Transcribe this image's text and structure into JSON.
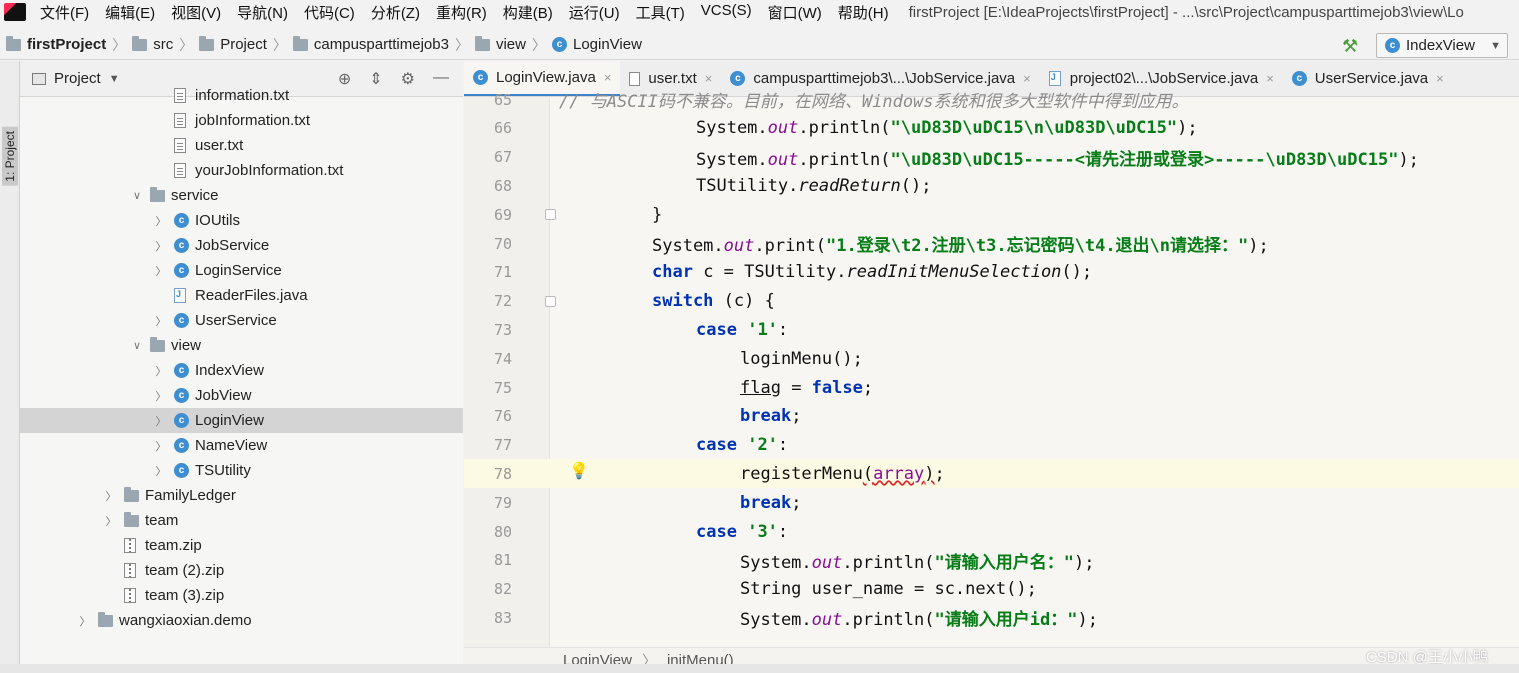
{
  "menubar": {
    "items": [
      "文件(F)",
      "编辑(E)",
      "视图(V)",
      "导航(N)",
      "代码(C)",
      "分析(Z)",
      "重构(R)",
      "构建(B)",
      "运行(U)",
      "工具(T)",
      "VCS(S)",
      "窗口(W)",
      "帮助(H)"
    ],
    "window_title": "firstProject [E:\\IdeaProjects\\firstProject] - ...\\src\\Project\\campusparttimejob3\\view\\Lo"
  },
  "breadcrumb": {
    "project": "firstProject",
    "items": [
      "src",
      "Project",
      "campusparttimejob3",
      "view"
    ],
    "current": "LoginView"
  },
  "run_config": {
    "label": "IndexView"
  },
  "toolstrip": {
    "project_label": "1: Project"
  },
  "project_panel": {
    "title": "Project",
    "tree": [
      {
        "label": "information.txt",
        "type": "file",
        "indent": 2
      },
      {
        "label": "jobInformation.txt",
        "type": "file",
        "indent": 2
      },
      {
        "label": "user.txt",
        "type": "file",
        "indent": 2
      },
      {
        "label": "yourJobInformation.txt",
        "type": "file",
        "indent": 2
      },
      {
        "label": "service",
        "type": "folder-open",
        "indent": 1
      },
      {
        "label": "IOUtils",
        "type": "class",
        "indent": 2
      },
      {
        "label": "JobService",
        "type": "class",
        "indent": 2
      },
      {
        "label": "LoginService",
        "type": "class",
        "indent": 2
      },
      {
        "label": "ReaderFiles.java",
        "type": "java",
        "indent": 2
      },
      {
        "label": "UserService",
        "type": "class",
        "indent": 2
      },
      {
        "label": "view",
        "type": "folder-open",
        "indent": 1
      },
      {
        "label": "IndexView",
        "type": "class",
        "indent": 2
      },
      {
        "label": "JobView",
        "type": "class",
        "indent": 2
      },
      {
        "label": "LoginView",
        "type": "class",
        "indent": 2,
        "selected": true
      },
      {
        "label": "NameView",
        "type": "class",
        "indent": 2
      },
      {
        "label": "TSUtility",
        "type": "class",
        "indent": 2
      },
      {
        "label": "FamilyLedger",
        "type": "folder",
        "indent": 0
      },
      {
        "label": "team",
        "type": "folder",
        "indent": 0
      },
      {
        "label": "team.zip",
        "type": "zip",
        "indent": 0
      },
      {
        "label": "team (2).zip",
        "type": "zip",
        "indent": 0
      },
      {
        "label": "team (3).zip",
        "type": "zip",
        "indent": 0
      },
      {
        "label": "wangxiaoxian.demo",
        "type": "folder",
        "indent": -1
      }
    ]
  },
  "editor": {
    "tabs": [
      {
        "label": "LoginView.java",
        "icon": "class",
        "active": true
      },
      {
        "label": "user.txt",
        "icon": "txt"
      },
      {
        "label": "campusparttimejob3\\...\\JobService.java",
        "icon": "class"
      },
      {
        "label": "project02\\...\\JobService.java",
        "icon": "java"
      },
      {
        "label": "UserService.java",
        "icon": "class"
      }
    ],
    "lines": [
      {
        "n": "65",
        "html": "<span class=\"cmt\">// 与ASCII码不兼容。目前，在网络、Windows系统和很多大型软件中得到应用。</span>",
        "indent": 0
      },
      {
        "n": "66",
        "html": "System.<span class=\"field\">out</span>.println(<span class=\"str\">\"\\uD83D\\uDC15\\n\\uD83D\\uDC15\"</span>);",
        "indent": 4
      },
      {
        "n": "67",
        "html": "System.<span class=\"field\">out</span>.println(<span class=\"str\">\"\\uD83D\\uDC15-----&lt;请先注册或登录&gt;-----\\uD83D\\uDC15\"</span>);",
        "indent": 4
      },
      {
        "n": "68",
        "html": "TSUtility.<span class=\"static\">readReturn</span>();",
        "indent": 4
      },
      {
        "n": "69",
        "html": "}",
        "indent": 3
      },
      {
        "n": "70",
        "html": "System.<span class=\"field\">out</span>.print(<span class=\"str\">\"1.登录\\t2.注册\\t3.忘记密码\\t4.退出\\n请选择：\"</span>);",
        "indent": 3
      },
      {
        "n": "71",
        "html": "<span class=\"kw\">char</span> c = TSUtility.<span class=\"static\">readInitMenuSelection</span>();",
        "indent": 3
      },
      {
        "n": "72",
        "html": "<span class=\"kw\">switch</span> (c) {",
        "indent": 3
      },
      {
        "n": "73",
        "html": "<span class=\"kw\">case</span> <span class=\"str\">'1'</span>:",
        "indent": 4
      },
      {
        "n": "74",
        "html": "loginMenu();",
        "indent": 5
      },
      {
        "n": "75",
        "html": "<u>flag</u> = <span class=\"kw\">false</span>;",
        "indent": 5
      },
      {
        "n": "76",
        "html": "<span class=\"kw\">break</span>;",
        "indent": 5
      },
      {
        "n": "77",
        "html": "<span class=\"kw\">case</span> <span class=\"str\">'2'</span>:",
        "indent": 4
      },
      {
        "n": "78",
        "html": "registerMenu<span class=\"squiggle\">(<span class=\"field\" style=\"font-style:normal\">array</span>)</span>;",
        "indent": 5,
        "current": true
      },
      {
        "n": "79",
        "html": "<span class=\"kw\">break</span>;",
        "indent": 5
      },
      {
        "n": "80",
        "html": "<span class=\"kw\">case</span> <span class=\"str\">'3'</span>:",
        "indent": 4
      },
      {
        "n": "81",
        "html": "System.<span class=\"field\">out</span>.println(<span class=\"str\">\"请输入用户名：\"</span>);",
        "indent": 5
      },
      {
        "n": "82",
        "html": "String user_name = sc.next();",
        "indent": 5
      },
      {
        "n": "83",
        "html": "System.<span class=\"field\">out</span>.println(<span class=\"str\">\"请输入用户id：\"</span>);",
        "indent": 5
      }
    ],
    "crumbs": [
      "LoginView",
      "initMenu()"
    ]
  },
  "watermark": "CSDN @王小小鸭",
  "colors": {
    "keyword": "#0033b3",
    "string": "#067d17",
    "field": "#871094",
    "accent": "#4083c9"
  }
}
